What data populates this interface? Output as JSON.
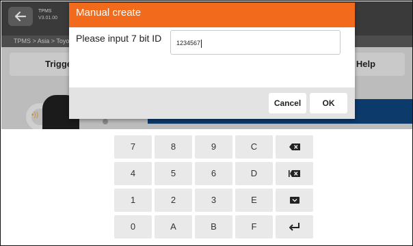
{
  "app": {
    "title": "TPMS",
    "version": "V3.01.00",
    "breadcrumb": "TPMS > Asia > Toyot",
    "trigger_button": "Trigge",
    "learn_help_button": "arn Help"
  },
  "dialog": {
    "title": "Manual create",
    "prompt": "Please input 7 bit ID",
    "input_value": "1234567",
    "cancel_label": "Cancel",
    "ok_label": "OK"
  },
  "keyboard": {
    "rows": [
      [
        "7",
        "8",
        "9",
        "C",
        "backspace-icon"
      ],
      [
        "4",
        "5",
        "6",
        "D",
        "clear-icon"
      ],
      [
        "1",
        "2",
        "3",
        "E",
        "hide-keyboard-icon"
      ],
      [
        "0",
        "A",
        "B",
        "F",
        "enter-icon"
      ]
    ]
  },
  "colors": {
    "dialog_header": "#f26a1b",
    "app_header": "#3a3a3a",
    "key_bg": "#e9e9e9",
    "blue_bar": "#0c3a6b"
  }
}
